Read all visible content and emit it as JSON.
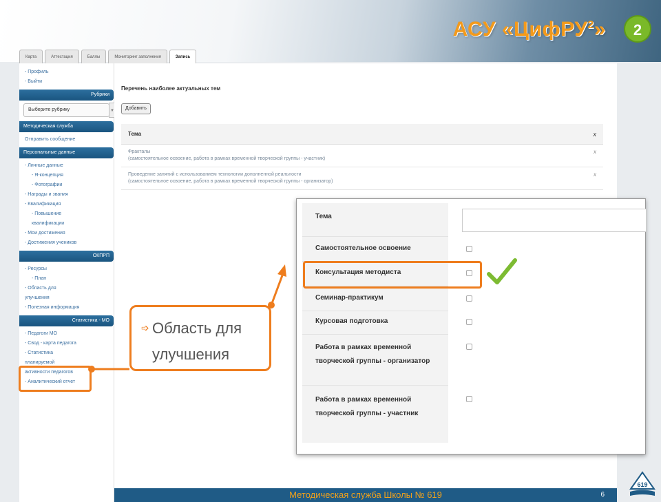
{
  "header": {
    "brand": "АСУ «ЦифРУ",
    "brand_sup": "2",
    "brand_end": "»",
    "slide_number": "2"
  },
  "tabs": [
    {
      "label": "Карта",
      "active": false
    },
    {
      "label": "Аттестация",
      "active": false
    },
    {
      "label": "Баллы",
      "active": false
    },
    {
      "label": "Мониторинг заполнения",
      "active": false
    },
    {
      "label": "Запись",
      "active": true
    }
  ],
  "sidebar": {
    "links_top": [
      "- Профиль",
      "- Выйти"
    ],
    "rubric_head": "Рубрики",
    "rubric_select": "Выберите рубрику",
    "method_head": "Методическая служба",
    "send_message": "Отправить сообщение",
    "personal_head": "Персональные данные",
    "personal_items": [
      {
        "label": "- Личные данные",
        "level": 1
      },
      {
        "label": "- Я-концепция",
        "level": 2
      },
      {
        "label": "- Фотографии",
        "level": 2
      },
      {
        "label": "- Награды и звания",
        "level": 1
      },
      {
        "label": "- Квалификация",
        "level": 1
      },
      {
        "label": "- Повышение",
        "level": 2
      },
      {
        "label": "квалификации",
        "level": 2
      },
      {
        "label": "- Мои достижения",
        "level": 1
      },
      {
        "label": "- Достижения учеников",
        "level": 1
      }
    ],
    "okgpd_head": "ОКПРП",
    "okgpd_items": [
      {
        "label": "- Ресурсы",
        "level": 1
      },
      {
        "label": "- План",
        "level": 2
      },
      {
        "label": "- Область для",
        "level": 1
      },
      {
        "label": "улучшения",
        "level": 1
      },
      {
        "label": "- Полезная информация",
        "level": 1
      }
    ],
    "stats_head": "Статистика - МО",
    "stats_items": [
      {
        "label": "- Педагоги МО",
        "level": 1
      },
      {
        "label": "- Свод - карта педагога",
        "level": 1
      },
      {
        "label": "- Статистика",
        "level": 1
      },
      {
        "label": "планируемой",
        "level": 1
      },
      {
        "label": "активности педагогов",
        "level": 1
      },
      {
        "label": "- Аналитический отчет",
        "level": 1
      }
    ]
  },
  "main": {
    "title": "Перечень наиболее актуальных тем",
    "add_button": "Добавить",
    "table": {
      "header": "Тема",
      "delete_symbol": "x",
      "rows": [
        {
          "title": "Фракталы",
          "detail": "(самостоятельное освоение, работа в рамках временной творческой группы - участник)"
        },
        {
          "title": "Проведение занятий с использованием технологии дополненной реальности",
          "detail": "(самостоятельное освоение, работа в рамках временной творческой группы - организатор)"
        }
      ]
    }
  },
  "popup": {
    "fields": [
      {
        "label": "Тема",
        "type": "text"
      },
      {
        "label": "Самостоятельное освоение",
        "type": "checkbox"
      },
      {
        "label": "Консультация методиста",
        "type": "checkbox"
      },
      {
        "label": "Семинар-практикум",
        "type": "checkbox"
      },
      {
        "label": "Курсовая подготовка",
        "type": "checkbox"
      },
      {
        "label": "Работа в рамках временной творческой группы - организатор",
        "type": "checkbox"
      },
      {
        "label": "Работа в рамках временной творческой группы - участник",
        "type": "checkbox"
      }
    ]
  },
  "callout": {
    "line1": "Область для",
    "line2": "улучшения"
  },
  "footer": {
    "text": "Методическая служба Школы № 619",
    "page": "6"
  },
  "logo": {
    "text": "619"
  },
  "colors": {
    "accent_orange": "#ee7d1e",
    "brand_orange": "#f39a1b",
    "nav_blue": "#1f5b86",
    "badge_green": "#7ab929",
    "check_green": "#7dbb32"
  }
}
